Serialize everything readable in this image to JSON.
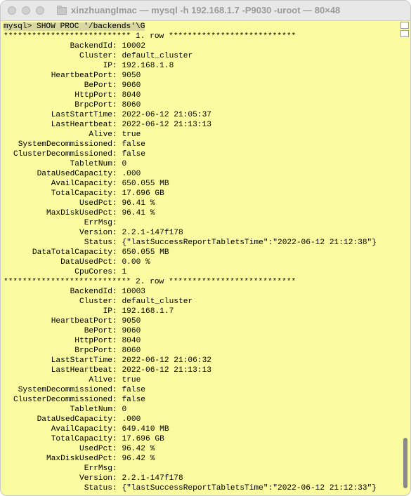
{
  "window": {
    "title": "xinzhuangImac — mysql -h 192.168.1.7 -P9030 -uroot — 80×48"
  },
  "terminal": {
    "prompt": "mysql> ",
    "command": "SHOW PROC '/backends'\\G",
    "rows": [
      {
        "separator": "*************************** 1. row ***************************",
        "fields": [
          {
            "k": "BackendId",
            "v": "10002"
          },
          {
            "k": "Cluster",
            "v": "default_cluster"
          },
          {
            "k": "IP",
            "v": "192.168.1.8"
          },
          {
            "k": "HeartbeatPort",
            "v": "9050"
          },
          {
            "k": "BePort",
            "v": "9060"
          },
          {
            "k": "HttpPort",
            "v": "8040"
          },
          {
            "k": "BrpcPort",
            "v": "8060"
          },
          {
            "k": "LastStartTime",
            "v": "2022-06-12 21:05:37"
          },
          {
            "k": "LastHeartbeat",
            "v": "2022-06-12 21:13:13"
          },
          {
            "k": "Alive",
            "v": "true"
          },
          {
            "k": "SystemDecommissioned",
            "v": "false"
          },
          {
            "k": "ClusterDecommissioned",
            "v": "false"
          },
          {
            "k": "TabletNum",
            "v": "0"
          },
          {
            "k": "DataUsedCapacity",
            "v": ".000"
          },
          {
            "k": "AvailCapacity",
            "v": "650.055 MB"
          },
          {
            "k": "TotalCapacity",
            "v": "17.696 GB"
          },
          {
            "k": "UsedPct",
            "v": "96.41 %"
          },
          {
            "k": "MaxDiskUsedPct",
            "v": "96.41 %"
          },
          {
            "k": "ErrMsg",
            "v": ""
          },
          {
            "k": "Version",
            "v": "2.2.1-147f178"
          },
          {
            "k": "Status",
            "v": "{\"lastSuccessReportTabletsTime\":\"2022-06-12 21:12:38\"}"
          },
          {
            "k": "DataTotalCapacity",
            "v": "650.055 MB"
          },
          {
            "k": "DataUsedPct",
            "v": "0.00 %"
          },
          {
            "k": "CpuCores",
            "v": "1"
          }
        ]
      },
      {
        "separator": "*************************** 2. row ***************************",
        "fields": [
          {
            "k": "BackendId",
            "v": "10003"
          },
          {
            "k": "Cluster",
            "v": "default_cluster"
          },
          {
            "k": "IP",
            "v": "192.168.1.7"
          },
          {
            "k": "HeartbeatPort",
            "v": "9050"
          },
          {
            "k": "BePort",
            "v": "9060"
          },
          {
            "k": "HttpPort",
            "v": "8040"
          },
          {
            "k": "BrpcPort",
            "v": "8060"
          },
          {
            "k": "LastStartTime",
            "v": "2022-06-12 21:06:32"
          },
          {
            "k": "LastHeartbeat",
            "v": "2022-06-12 21:13:13"
          },
          {
            "k": "Alive",
            "v": "true"
          },
          {
            "k": "SystemDecommissioned",
            "v": "false"
          },
          {
            "k": "ClusterDecommissioned",
            "v": "false"
          },
          {
            "k": "TabletNum",
            "v": "0"
          },
          {
            "k": "DataUsedCapacity",
            "v": ".000"
          },
          {
            "k": "AvailCapacity",
            "v": "649.410 MB"
          },
          {
            "k": "TotalCapacity",
            "v": "17.696 GB"
          },
          {
            "k": "UsedPct",
            "v": "96.42 %"
          },
          {
            "k": "MaxDiskUsedPct",
            "v": "96.42 %"
          },
          {
            "k": "ErrMsg",
            "v": ""
          },
          {
            "k": "Version",
            "v": "2.2.1-147f178"
          },
          {
            "k": "Status",
            "v": "{\"lastSuccessReportTabletsTime\":\"2022-06-12 21:12:33\"}"
          }
        ]
      }
    ]
  }
}
